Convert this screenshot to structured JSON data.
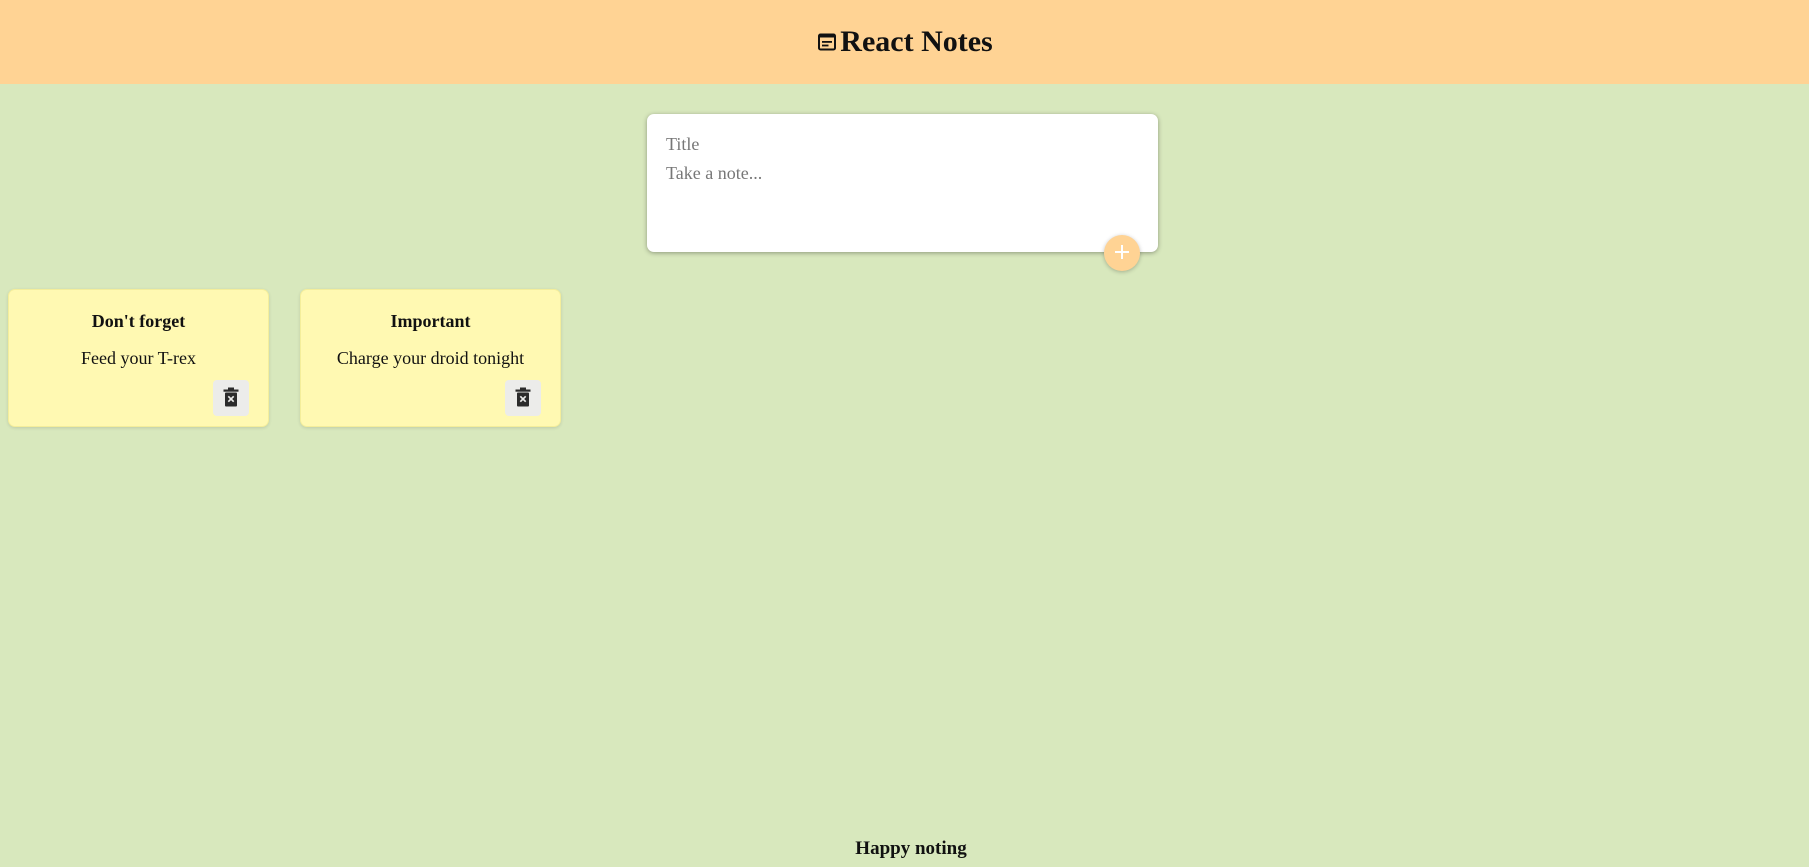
{
  "header": {
    "title": "React Notes",
    "icon": "note-icon",
    "background": "#ffd394"
  },
  "composer": {
    "title_placeholder": "Title",
    "content_placeholder": "Take a note...",
    "add_icon": "plus-icon"
  },
  "notes": [
    {
      "title": "Don't forget",
      "content": "Feed your T-rex",
      "delete_icon": "trash-icon"
    },
    {
      "title": "Important",
      "content": "Charge your droid tonight",
      "delete_icon": "trash-icon"
    }
  ],
  "footer": {
    "text": "Happy noting"
  },
  "colors": {
    "page_background": "#d8e8bd",
    "header_background": "#ffd394",
    "note_background": "#fff9b2"
  }
}
